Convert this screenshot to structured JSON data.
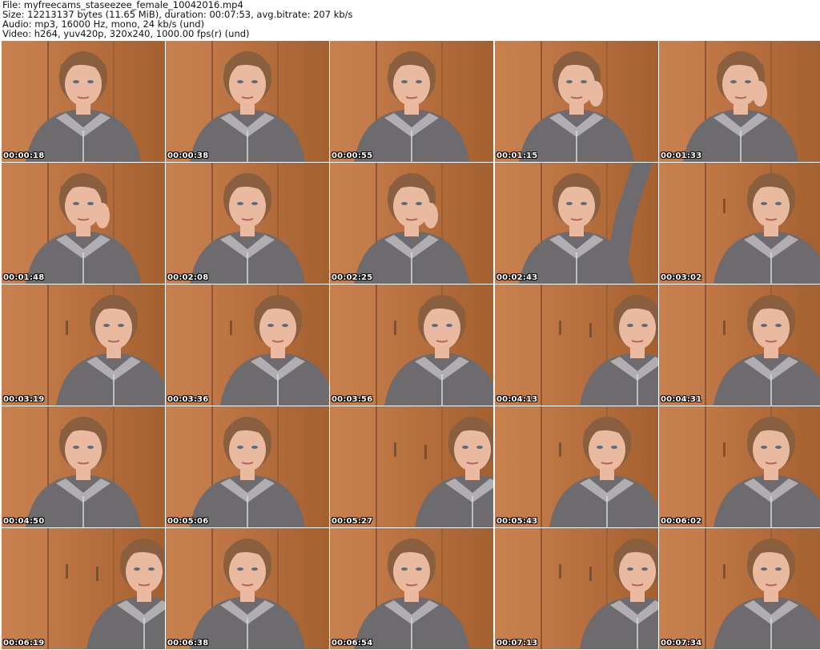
{
  "header": {
    "file_line": "File: myfreecams_staseezee_female_10042016.mp4",
    "size_line": "Size: 12213137 bytes (11.65 MiB), duration: 00:07:53, avg.bitrate: 207 kb/s",
    "audio_line": "Audio: mp3, 16000 Hz, mono, 24 kb/s (und)",
    "video_line": "Video: h264, yuv420p, 320x240, 1000.00 fps(r) (und)"
  },
  "thumbnails": [
    {
      "timestamp": "00:00:18",
      "pose": "center"
    },
    {
      "timestamp": "00:00:38",
      "pose": "center"
    },
    {
      "timestamp": "00:00:55",
      "pose": "center"
    },
    {
      "timestamp": "00:01:15",
      "pose": "hand"
    },
    {
      "timestamp": "00:01:33",
      "pose": "hand"
    },
    {
      "timestamp": "00:01:48",
      "pose": "hand"
    },
    {
      "timestamp": "00:02:08",
      "pose": "center"
    },
    {
      "timestamp": "00:02:25",
      "pose": "hand"
    },
    {
      "timestamp": "00:02:43",
      "pose": "arm-up"
    },
    {
      "timestamp": "00:03:02",
      "pose": "right"
    },
    {
      "timestamp": "00:03:19",
      "pose": "right"
    },
    {
      "timestamp": "00:03:36",
      "pose": "right"
    },
    {
      "timestamp": "00:03:56",
      "pose": "right"
    },
    {
      "timestamp": "00:04:13",
      "pose": "far-right"
    },
    {
      "timestamp": "00:04:31",
      "pose": "right"
    },
    {
      "timestamp": "00:04:50",
      "pose": "center"
    },
    {
      "timestamp": "00:05:06",
      "pose": "center"
    },
    {
      "timestamp": "00:05:27",
      "pose": "far-right"
    },
    {
      "timestamp": "00:05:43",
      "pose": "right"
    },
    {
      "timestamp": "00:06:02",
      "pose": "right"
    },
    {
      "timestamp": "00:06:19",
      "pose": "far-right"
    },
    {
      "timestamp": "00:06:38",
      "pose": "center"
    },
    {
      "timestamp": "00:06:54",
      "pose": "center"
    },
    {
      "timestamp": "00:07:13",
      "pose": "far-right"
    },
    {
      "timestamp": "00:07:34",
      "pose": "right"
    }
  ],
  "colors": {
    "wood": "#b8703f",
    "wood_dark": "#8f5430",
    "sweater": "#6d6b6e",
    "skin": "#e9b9a0",
    "hair": "#8a5f3f"
  }
}
